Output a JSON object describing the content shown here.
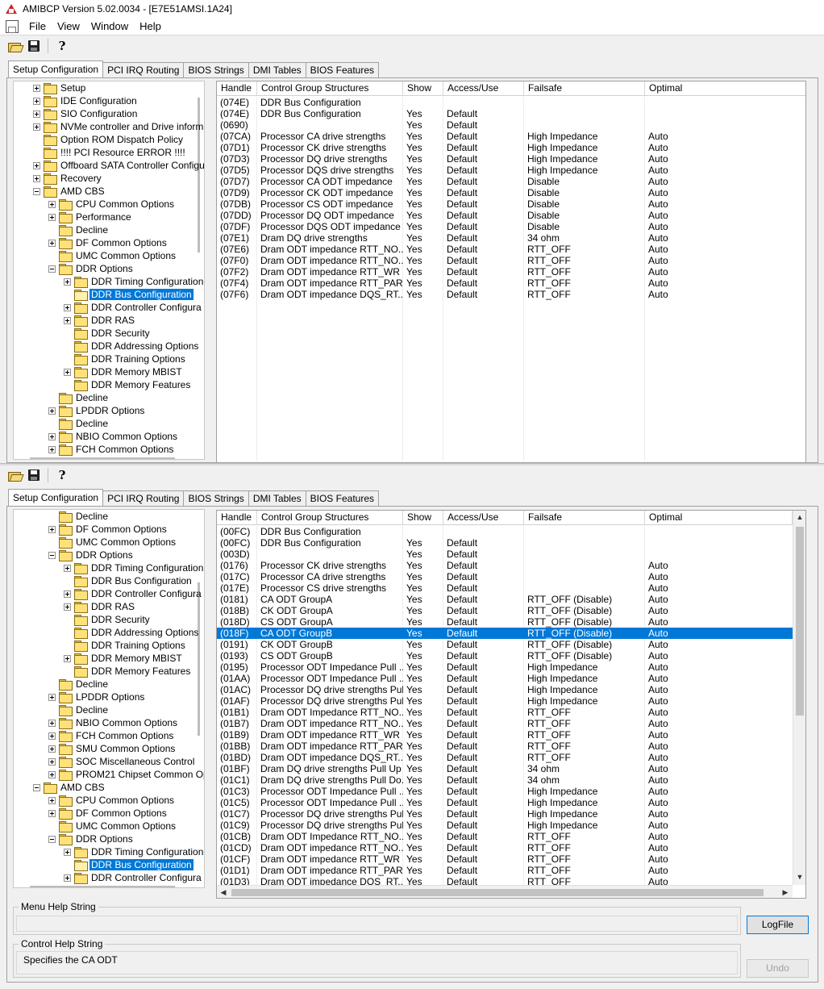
{
  "window": {
    "title": "AMIBCP Version 5.02.0034 - [E7E51AMSI.1A24]"
  },
  "menu": [
    "File",
    "View",
    "Window",
    "Help"
  ],
  "tabs": [
    "Setup Configuration",
    "PCI IRQ Routing",
    "BIOS Strings",
    "DMI Tables",
    "BIOS Features"
  ],
  "columns": [
    "Handle",
    "Control Group Structures",
    "Show",
    "Access/Use",
    "Failsafe",
    "Optimal"
  ],
  "top_pane": {
    "tree": [
      {
        "label": "Setup",
        "indent": 0,
        "exp": "plus",
        "folder": "closed"
      },
      {
        "label": "IDE Configuration",
        "indent": 0,
        "exp": "plus",
        "folder": "closed"
      },
      {
        "label": "SIO Configuration",
        "indent": 0,
        "exp": "plus",
        "folder": "closed"
      },
      {
        "label": "NVMe controller and Drive informa",
        "indent": 0,
        "exp": "plus",
        "folder": "closed"
      },
      {
        "label": "Option ROM Dispatch Policy",
        "indent": 0,
        "exp": "none",
        "folder": "closed"
      },
      {
        "label": "!!!! PCI Resource ERROR !!!!",
        "indent": 0,
        "exp": "none",
        "folder": "closed"
      },
      {
        "label": "Offboard SATA Controller Configu",
        "indent": 0,
        "exp": "plus",
        "folder": "closed"
      },
      {
        "label": "Recovery",
        "indent": 0,
        "exp": "plus",
        "folder": "closed"
      },
      {
        "label": "AMD CBS",
        "indent": 0,
        "exp": "minus",
        "folder": "closed"
      },
      {
        "label": "CPU Common Options",
        "indent": 1,
        "exp": "plus",
        "folder": "closed"
      },
      {
        "label": "Performance",
        "indent": 1,
        "exp": "plus",
        "folder": "closed"
      },
      {
        "label": "Decline",
        "indent": 1,
        "exp": "none",
        "folder": "closed"
      },
      {
        "label": "DF Common Options",
        "indent": 1,
        "exp": "plus",
        "folder": "closed"
      },
      {
        "label": "UMC Common Options",
        "indent": 1,
        "exp": "none",
        "folder": "closed"
      },
      {
        "label": "DDR Options",
        "indent": 1,
        "exp": "minus",
        "folder": "closed"
      },
      {
        "label": "DDR Timing Configuration",
        "indent": 2,
        "exp": "plus",
        "folder": "closed"
      },
      {
        "label": "DDR Bus Configuration",
        "indent": 2,
        "exp": "none",
        "folder": "open",
        "selected": true
      },
      {
        "label": "DDR Controller Configura",
        "indent": 2,
        "exp": "plus",
        "folder": "closed"
      },
      {
        "label": "DDR RAS",
        "indent": 2,
        "exp": "plus",
        "folder": "closed"
      },
      {
        "label": "DDR Security",
        "indent": 2,
        "exp": "none",
        "folder": "closed"
      },
      {
        "label": "DDR Addressing Options",
        "indent": 2,
        "exp": "none",
        "folder": "closed"
      },
      {
        "label": "DDR Training Options",
        "indent": 2,
        "exp": "none",
        "folder": "closed"
      },
      {
        "label": "DDR Memory MBIST",
        "indent": 2,
        "exp": "plus",
        "folder": "closed"
      },
      {
        "label": "DDR Memory Features",
        "indent": 2,
        "exp": "none",
        "folder": "closed"
      },
      {
        "label": "Decline",
        "indent": 1,
        "exp": "none",
        "folder": "closed"
      },
      {
        "label": "LPDDR Options",
        "indent": 1,
        "exp": "plus",
        "folder": "closed"
      },
      {
        "label": "Decline",
        "indent": 1,
        "exp": "none",
        "folder": "closed"
      },
      {
        "label": "NBIO Common Options",
        "indent": 1,
        "exp": "plus",
        "folder": "closed"
      },
      {
        "label": "FCH Common Options",
        "indent": 1,
        "exp": "plus",
        "folder": "closed"
      }
    ],
    "rows": [
      [
        "(074E)",
        "DDR Bus Configuration",
        "",
        "",
        "",
        ""
      ],
      [
        "(074E)",
        "DDR Bus Configuration",
        "Yes",
        "Default",
        "",
        ""
      ],
      [
        "(0690)",
        "",
        "Yes",
        "Default",
        "",
        ""
      ],
      [
        "(07CA)",
        "Processor CA drive strengths",
        "Yes",
        "Default",
        "High Impedance",
        "Auto"
      ],
      [
        "(07D1)",
        "Processor CK drive strengths",
        "Yes",
        "Default",
        "High Impedance",
        "Auto"
      ],
      [
        "(07D3)",
        "Processor DQ drive strengths",
        "Yes",
        "Default",
        "High Impedance",
        "Auto"
      ],
      [
        "(07D5)",
        "Processor DQS drive strengths",
        "Yes",
        "Default",
        "High Impedance",
        "Auto"
      ],
      [
        "(07D7)",
        "Processor CA ODT impedance",
        "Yes",
        "Default",
        "Disable",
        "Auto"
      ],
      [
        "(07D9)",
        "Processor CK ODT impedance",
        "Yes",
        "Default",
        "Disable",
        "Auto"
      ],
      [
        "(07DB)",
        "Processor CS ODT impedance",
        "Yes",
        "Default",
        "Disable",
        "Auto"
      ],
      [
        "(07DD)",
        "Processor DQ ODT impedance",
        "Yes",
        "Default",
        "Disable",
        "Auto"
      ],
      [
        "(07DF)",
        "Processor DQS ODT impedance",
        "Yes",
        "Default",
        "Disable",
        "Auto"
      ],
      [
        "(07E1)",
        "Dram DQ drive strengths",
        "Yes",
        "Default",
        "34 ohm",
        "Auto"
      ],
      [
        "(07E6)",
        "Dram ODT impedance RTT_NO...",
        "Yes",
        "Default",
        "RTT_OFF",
        "Auto"
      ],
      [
        "(07F0)",
        "Dram ODT impedance RTT_NO...",
        "Yes",
        "Default",
        "RTT_OFF",
        "Auto"
      ],
      [
        "(07F2)",
        "Dram ODT impedance RTT_WR",
        "Yes",
        "Default",
        "RTT_OFF",
        "Auto"
      ],
      [
        "(07F4)",
        "Dram ODT impedance RTT_PARK",
        "Yes",
        "Default",
        "RTT_OFF",
        "Auto"
      ],
      [
        "(07F6)",
        "Dram ODT impedance DQS_RT...",
        "Yes",
        "Default",
        "RTT_OFF",
        "Auto"
      ]
    ]
  },
  "bottom_pane": {
    "tree": [
      {
        "label": "Decline",
        "indent": 1,
        "exp": "none",
        "folder": "closed"
      },
      {
        "label": "DF Common Options",
        "indent": 1,
        "exp": "plus",
        "folder": "closed"
      },
      {
        "label": "UMC Common Options",
        "indent": 1,
        "exp": "none",
        "folder": "closed"
      },
      {
        "label": "DDR Options",
        "indent": 1,
        "exp": "minus",
        "folder": "closed"
      },
      {
        "label": "DDR Timing Configuration",
        "indent": 2,
        "exp": "plus",
        "folder": "closed"
      },
      {
        "label": "DDR Bus Configuration",
        "indent": 2,
        "exp": "none",
        "folder": "closed"
      },
      {
        "label": "DDR Controller Configura",
        "indent": 2,
        "exp": "plus",
        "folder": "closed"
      },
      {
        "label": "DDR RAS",
        "indent": 2,
        "exp": "plus",
        "folder": "closed"
      },
      {
        "label": "DDR Security",
        "indent": 2,
        "exp": "none",
        "folder": "closed"
      },
      {
        "label": "DDR Addressing Options",
        "indent": 2,
        "exp": "none",
        "folder": "closed"
      },
      {
        "label": "DDR Training Options",
        "indent": 2,
        "exp": "none",
        "folder": "closed"
      },
      {
        "label": "DDR Memory MBIST",
        "indent": 2,
        "exp": "plus",
        "folder": "closed"
      },
      {
        "label": "DDR Memory Features",
        "indent": 2,
        "exp": "none",
        "folder": "closed"
      },
      {
        "label": "Decline",
        "indent": 1,
        "exp": "none",
        "folder": "closed"
      },
      {
        "label": "LPDDR Options",
        "indent": 1,
        "exp": "plus",
        "folder": "closed"
      },
      {
        "label": "Decline",
        "indent": 1,
        "exp": "none",
        "folder": "closed"
      },
      {
        "label": "NBIO Common Options",
        "indent": 1,
        "exp": "plus",
        "folder": "closed"
      },
      {
        "label": "FCH Common Options",
        "indent": 1,
        "exp": "plus",
        "folder": "closed"
      },
      {
        "label": "SMU Common Options",
        "indent": 1,
        "exp": "plus",
        "folder": "closed"
      },
      {
        "label": "SOC Miscellaneous Control",
        "indent": 1,
        "exp": "plus",
        "folder": "closed"
      },
      {
        "label": "PROM21 Chipset Common Op",
        "indent": 1,
        "exp": "plus",
        "folder": "closed"
      },
      {
        "label": "AMD CBS",
        "indent": 0,
        "exp": "minus",
        "folder": "closed"
      },
      {
        "label": "CPU Common Options",
        "indent": 1,
        "exp": "plus",
        "folder": "closed"
      },
      {
        "label": "DF Common Options",
        "indent": 1,
        "exp": "plus",
        "folder": "closed"
      },
      {
        "label": "UMC Common Options",
        "indent": 1,
        "exp": "none",
        "folder": "closed"
      },
      {
        "label": "DDR Options",
        "indent": 1,
        "exp": "minus",
        "folder": "closed"
      },
      {
        "label": "DDR Timing Configuration",
        "indent": 2,
        "exp": "plus",
        "folder": "closed"
      },
      {
        "label": "DDR Bus Configuration",
        "indent": 2,
        "exp": "none",
        "folder": "open",
        "selected": true
      },
      {
        "label": "DDR Controller Configura",
        "indent": 2,
        "exp": "plus",
        "folder": "closed"
      }
    ],
    "rows": [
      [
        "(00FC)",
        "DDR Bus Configuration",
        "",
        "",
        "",
        ""
      ],
      [
        "(00FC)",
        "DDR Bus Configuration",
        "Yes",
        "Default",
        "",
        ""
      ],
      [
        "(003D)",
        "",
        "Yes",
        "Default",
        "",
        ""
      ],
      [
        "(0176)",
        "Processor CK drive strengths",
        "Yes",
        "Default",
        "",
        "Auto"
      ],
      [
        "(017C)",
        "Processor CA drive strengths",
        "Yes",
        "Default",
        "",
        "Auto"
      ],
      [
        "(017E)",
        "Processor CS drive strengths",
        "Yes",
        "Default",
        "",
        "Auto"
      ],
      [
        "(0181)",
        "CA ODT GroupA",
        "Yes",
        "Default",
        "RTT_OFF (Disable)",
        "Auto"
      ],
      [
        "(018B)",
        "CK ODT GroupA",
        "Yes",
        "Default",
        "RTT_OFF (Disable)",
        "Auto"
      ],
      [
        "(018D)",
        "CS ODT GroupA",
        "Yes",
        "Default",
        "RTT_OFF (Disable)",
        "Auto"
      ],
      [
        "(018F)",
        "CA ODT GroupB",
        "Yes",
        "Default",
        "RTT_OFF (Disable)",
        "Auto"
      ],
      [
        "(0191)",
        "CK ODT GroupB",
        "Yes",
        "Default",
        "RTT_OFF (Disable)",
        "Auto"
      ],
      [
        "(0193)",
        "CS ODT GroupB",
        "Yes",
        "Default",
        "RTT_OFF (Disable)",
        "Auto"
      ],
      [
        "(0195)",
        "Processor ODT Impedance Pull ...",
        "Yes",
        "Default",
        "High Impedance",
        "Auto"
      ],
      [
        "(01AA)",
        "Processor ODT Impedance Pull ...",
        "Yes",
        "Default",
        "High Impedance",
        "Auto"
      ],
      [
        "(01AC)",
        "Processor DQ drive strengths Pull...",
        "Yes",
        "Default",
        "High Impedance",
        "Auto"
      ],
      [
        "(01AF)",
        "Processor DQ drive strengths Pull...",
        "Yes",
        "Default",
        "High Impedance",
        "Auto"
      ],
      [
        "(01B1)",
        "Dram ODT Impedance RTT_NO...",
        "Yes",
        "Default",
        "RTT_OFF",
        "Auto"
      ],
      [
        "(01B7)",
        "Dram ODT impedance RTT_NO...",
        "Yes",
        "Default",
        "RTT_OFF",
        "Auto"
      ],
      [
        "(01B9)",
        "Dram ODT impedance RTT_WR ...",
        "Yes",
        "Default",
        "RTT_OFF",
        "Auto"
      ],
      [
        "(01BB)",
        "Dram ODT impedance RTT_PAR...",
        "Yes",
        "Default",
        "RTT_OFF",
        "Auto"
      ],
      [
        "(01BD)",
        "Dram ODT impedance DQS_RT...",
        "Yes",
        "Default",
        "RTT_OFF",
        "Auto"
      ],
      [
        "(01BF)",
        "Dram DQ drive strengths Pull Up ...",
        "Yes",
        "Default",
        "34 ohm",
        "Auto"
      ],
      [
        "(01C1)",
        "Dram DQ drive strengths Pull Do...",
        "Yes",
        "Default",
        "34 ohm",
        "Auto"
      ],
      [
        "(01C3)",
        "Processor ODT Impedance Pull ...",
        "Yes",
        "Default",
        "High Impedance",
        "Auto"
      ],
      [
        "(01C5)",
        "Processor ODT Impedance Pull ...",
        "Yes",
        "Default",
        "High Impedance",
        "Auto"
      ],
      [
        "(01C7)",
        "Processor DQ drive strengths Pull...",
        "Yes",
        "Default",
        "High Impedance",
        "Auto"
      ],
      [
        "(01C9)",
        "Processor DQ drive strengths Pull...",
        "Yes",
        "Default",
        "High Impedance",
        "Auto"
      ],
      [
        "(01CB)",
        "Dram ODT Impedance RTT_NO...",
        "Yes",
        "Default",
        "RTT_OFF",
        "Auto"
      ],
      [
        "(01CD)",
        "Dram ODT impedance RTT_NO...",
        "Yes",
        "Default",
        "RTT_OFF",
        "Auto"
      ],
      [
        "(01CF)",
        "Dram ODT impedance RTT_WR ...",
        "Yes",
        "Default",
        "RTT_OFF",
        "Auto"
      ],
      [
        "(01D1)",
        "Dram ODT impedance RTT_PAR...",
        "Yes",
        "Default",
        "RTT_OFF",
        "Auto"
      ],
      [
        "(01D3)",
        "Dram ODT impedance DQS_RT...",
        "Yes",
        "Default",
        "RTT_OFF",
        "Auto"
      ]
    ],
    "selected_row": 9
  },
  "help": {
    "menu_title": "Menu Help String",
    "menu_text": "",
    "control_title": "Control Help String",
    "control_text": "Specifies the CA ODT"
  },
  "buttons": {
    "logfile": "LogFile",
    "undo": "Undo"
  },
  "colors": {
    "selection": "#0078d7",
    "background": "#f0f0f0"
  }
}
